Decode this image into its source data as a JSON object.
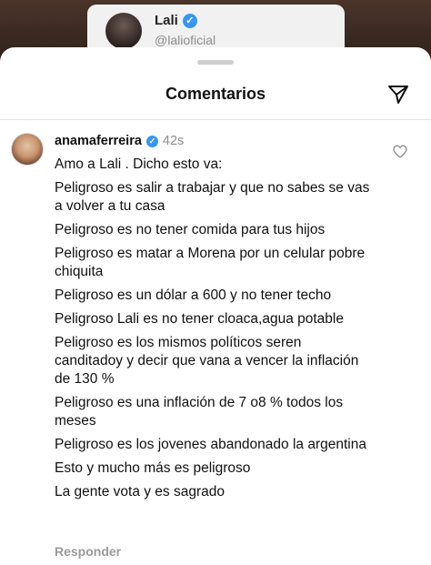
{
  "background_post": {
    "name": "Lali",
    "handle": "@lalioficial"
  },
  "sheet": {
    "title": "Comentarios"
  },
  "comment": {
    "username": "anamaferreira",
    "time": "42s",
    "lines": [
      "Amo a Lali . Dicho esto va:",
      "Peligroso es salir a trabajar y que no sabes se vas a volver a tu casa",
      "Peligroso es no tener comida para tus hijos",
      "Peligroso es matar a Morena por un celular pobre chiquita",
      "Peligroso es un dólar a 600 y no tener techo",
      "Peligroso Lali es no tener cloaca,agua potable",
      "Peligroso es los mismos políticos seren canditadoy y decir que vana a vencer la inflación de 130 %",
      "Peligroso es una inflación de 7 o8 % todos los meses",
      "Peligroso es los jovenes abandonado la argentina",
      "Esto y mucho más es peligroso",
      "La gente vota y es sagrado"
    ],
    "reply_label": "Responder"
  },
  "colors": {
    "verified": "#3797f0",
    "muted": "#8e8e8e"
  }
}
